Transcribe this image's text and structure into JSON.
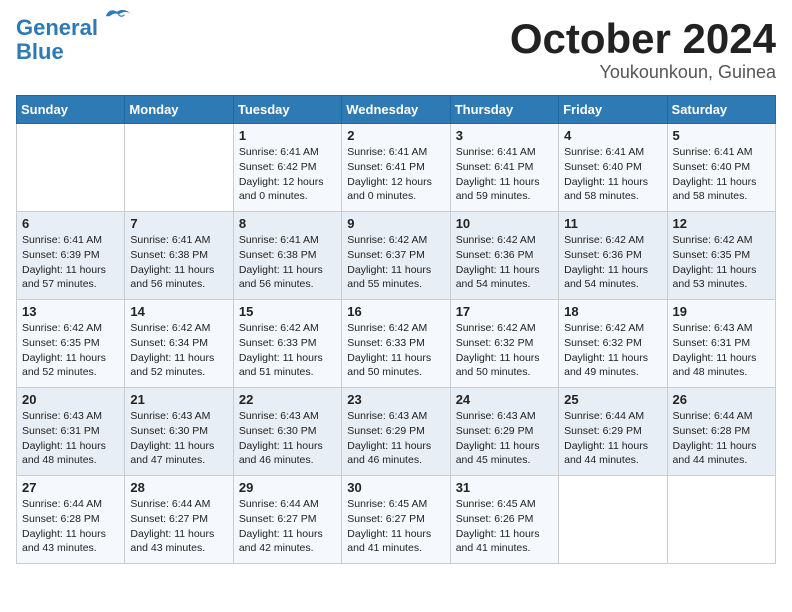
{
  "logo": {
    "line1": "General",
    "line2": "Blue"
  },
  "title": "October 2024",
  "location": "Youkounkoun, Guinea",
  "days_header": [
    "Sunday",
    "Monday",
    "Tuesday",
    "Wednesday",
    "Thursday",
    "Friday",
    "Saturday"
  ],
  "weeks": [
    [
      {
        "num": "",
        "sunrise": "",
        "sunset": "",
        "daylight": ""
      },
      {
        "num": "",
        "sunrise": "",
        "sunset": "",
        "daylight": ""
      },
      {
        "num": "1",
        "sunrise": "Sunrise: 6:41 AM",
        "sunset": "Sunset: 6:42 PM",
        "daylight": "Daylight: 12 hours and 0 minutes."
      },
      {
        "num": "2",
        "sunrise": "Sunrise: 6:41 AM",
        "sunset": "Sunset: 6:41 PM",
        "daylight": "Daylight: 12 hours and 0 minutes."
      },
      {
        "num": "3",
        "sunrise": "Sunrise: 6:41 AM",
        "sunset": "Sunset: 6:41 PM",
        "daylight": "Daylight: 11 hours and 59 minutes."
      },
      {
        "num": "4",
        "sunrise": "Sunrise: 6:41 AM",
        "sunset": "Sunset: 6:40 PM",
        "daylight": "Daylight: 11 hours and 58 minutes."
      },
      {
        "num": "5",
        "sunrise": "Sunrise: 6:41 AM",
        "sunset": "Sunset: 6:40 PM",
        "daylight": "Daylight: 11 hours and 58 minutes."
      }
    ],
    [
      {
        "num": "6",
        "sunrise": "Sunrise: 6:41 AM",
        "sunset": "Sunset: 6:39 PM",
        "daylight": "Daylight: 11 hours and 57 minutes."
      },
      {
        "num": "7",
        "sunrise": "Sunrise: 6:41 AM",
        "sunset": "Sunset: 6:38 PM",
        "daylight": "Daylight: 11 hours and 56 minutes."
      },
      {
        "num": "8",
        "sunrise": "Sunrise: 6:41 AM",
        "sunset": "Sunset: 6:38 PM",
        "daylight": "Daylight: 11 hours and 56 minutes."
      },
      {
        "num": "9",
        "sunrise": "Sunrise: 6:42 AM",
        "sunset": "Sunset: 6:37 PM",
        "daylight": "Daylight: 11 hours and 55 minutes."
      },
      {
        "num": "10",
        "sunrise": "Sunrise: 6:42 AM",
        "sunset": "Sunset: 6:36 PM",
        "daylight": "Daylight: 11 hours and 54 minutes."
      },
      {
        "num": "11",
        "sunrise": "Sunrise: 6:42 AM",
        "sunset": "Sunset: 6:36 PM",
        "daylight": "Daylight: 11 hours and 54 minutes."
      },
      {
        "num": "12",
        "sunrise": "Sunrise: 6:42 AM",
        "sunset": "Sunset: 6:35 PM",
        "daylight": "Daylight: 11 hours and 53 minutes."
      }
    ],
    [
      {
        "num": "13",
        "sunrise": "Sunrise: 6:42 AM",
        "sunset": "Sunset: 6:35 PM",
        "daylight": "Daylight: 11 hours and 52 minutes."
      },
      {
        "num": "14",
        "sunrise": "Sunrise: 6:42 AM",
        "sunset": "Sunset: 6:34 PM",
        "daylight": "Daylight: 11 hours and 52 minutes."
      },
      {
        "num": "15",
        "sunrise": "Sunrise: 6:42 AM",
        "sunset": "Sunset: 6:33 PM",
        "daylight": "Daylight: 11 hours and 51 minutes."
      },
      {
        "num": "16",
        "sunrise": "Sunrise: 6:42 AM",
        "sunset": "Sunset: 6:33 PM",
        "daylight": "Daylight: 11 hours and 50 minutes."
      },
      {
        "num": "17",
        "sunrise": "Sunrise: 6:42 AM",
        "sunset": "Sunset: 6:32 PM",
        "daylight": "Daylight: 11 hours and 50 minutes."
      },
      {
        "num": "18",
        "sunrise": "Sunrise: 6:42 AM",
        "sunset": "Sunset: 6:32 PM",
        "daylight": "Daylight: 11 hours and 49 minutes."
      },
      {
        "num": "19",
        "sunrise": "Sunrise: 6:43 AM",
        "sunset": "Sunset: 6:31 PM",
        "daylight": "Daylight: 11 hours and 48 minutes."
      }
    ],
    [
      {
        "num": "20",
        "sunrise": "Sunrise: 6:43 AM",
        "sunset": "Sunset: 6:31 PM",
        "daylight": "Daylight: 11 hours and 48 minutes."
      },
      {
        "num": "21",
        "sunrise": "Sunrise: 6:43 AM",
        "sunset": "Sunset: 6:30 PM",
        "daylight": "Daylight: 11 hours and 47 minutes."
      },
      {
        "num": "22",
        "sunrise": "Sunrise: 6:43 AM",
        "sunset": "Sunset: 6:30 PM",
        "daylight": "Daylight: 11 hours and 46 minutes."
      },
      {
        "num": "23",
        "sunrise": "Sunrise: 6:43 AM",
        "sunset": "Sunset: 6:29 PM",
        "daylight": "Daylight: 11 hours and 46 minutes."
      },
      {
        "num": "24",
        "sunrise": "Sunrise: 6:43 AM",
        "sunset": "Sunset: 6:29 PM",
        "daylight": "Daylight: 11 hours and 45 minutes."
      },
      {
        "num": "25",
        "sunrise": "Sunrise: 6:44 AM",
        "sunset": "Sunset: 6:29 PM",
        "daylight": "Daylight: 11 hours and 44 minutes."
      },
      {
        "num": "26",
        "sunrise": "Sunrise: 6:44 AM",
        "sunset": "Sunset: 6:28 PM",
        "daylight": "Daylight: 11 hours and 44 minutes."
      }
    ],
    [
      {
        "num": "27",
        "sunrise": "Sunrise: 6:44 AM",
        "sunset": "Sunset: 6:28 PM",
        "daylight": "Daylight: 11 hours and 43 minutes."
      },
      {
        "num": "28",
        "sunrise": "Sunrise: 6:44 AM",
        "sunset": "Sunset: 6:27 PM",
        "daylight": "Daylight: 11 hours and 43 minutes."
      },
      {
        "num": "29",
        "sunrise": "Sunrise: 6:44 AM",
        "sunset": "Sunset: 6:27 PM",
        "daylight": "Daylight: 11 hours and 42 minutes."
      },
      {
        "num": "30",
        "sunrise": "Sunrise: 6:45 AM",
        "sunset": "Sunset: 6:27 PM",
        "daylight": "Daylight: 11 hours and 41 minutes."
      },
      {
        "num": "31",
        "sunrise": "Sunrise: 6:45 AM",
        "sunset": "Sunset: 6:26 PM",
        "daylight": "Daylight: 11 hours and 41 minutes."
      },
      {
        "num": "",
        "sunrise": "",
        "sunset": "",
        "daylight": ""
      },
      {
        "num": "",
        "sunrise": "",
        "sunset": "",
        "daylight": ""
      }
    ]
  ]
}
